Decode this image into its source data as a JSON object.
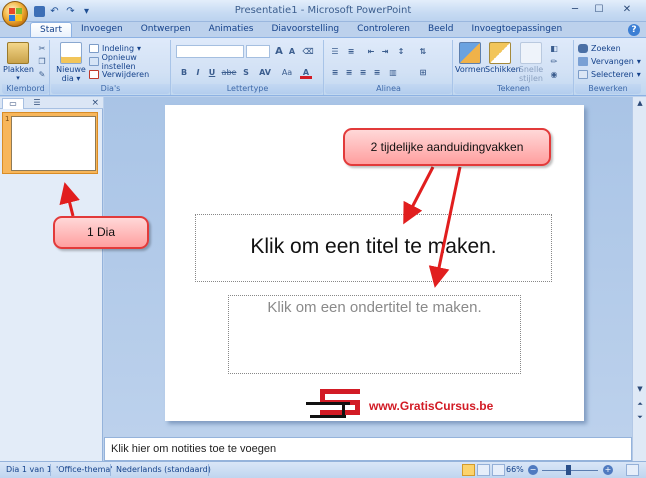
{
  "window": {
    "title": "Presentatie1 - Microsoft PowerPoint"
  },
  "tabs": [
    "Start",
    "Invoegen",
    "Ontwerpen",
    "Animaties",
    "Diavoorstelling",
    "Controleren",
    "Beeld",
    "Invoegtoepassingen"
  ],
  "ribbon": {
    "klembord": {
      "label": "Klembord",
      "paste": "Plakken"
    },
    "dias": {
      "label": "Dia's",
      "new_slide_1": "Nieuwe",
      "new_slide_2": "dia",
      "layout": "Indeling",
      "reset": "Opnieuw instellen",
      "delete": "Verwijderen"
    },
    "lettertype": {
      "label": "Lettertype",
      "bold": "B",
      "italic": "I",
      "underline": "U",
      "strike": "abe",
      "shadow": "S",
      "spacing": "AV",
      "case": "Aa",
      "grow": "A",
      "shrink": "A"
    },
    "alinea": {
      "label": "Alinea"
    },
    "tekenen": {
      "label": "Tekenen",
      "shapes": "Vormen",
      "arrange": "Schikken",
      "quick_styles_1": "Snelle",
      "quick_styles_2": "stijlen"
    },
    "bewerken": {
      "label": "Bewerken",
      "find": "Zoeken",
      "replace": "Vervangen",
      "select": "Selecteren"
    }
  },
  "slide_pane": {
    "thumb_number": "1"
  },
  "slide": {
    "title_placeholder": "Klik om een titel te maken.",
    "subtitle_placeholder": "Klik om een ondertitel te maken.",
    "logo_text": "www.GratisCursus.be"
  },
  "callouts": {
    "placeholders": "2 tijdelijke aanduidingvakken",
    "slide": "1 Dia"
  },
  "notes": {
    "placeholder": "Klik hier om notities toe te voegen"
  },
  "status": {
    "slide": "Dia 1 van 1",
    "theme": "'Office-thema'",
    "language": "Nederlands (standaard)",
    "zoom": "66%"
  },
  "colors": {
    "callout_fill": "#ff9f9f",
    "callout_border": "#e23a3a",
    "thumb_selected": "#f7b65b",
    "logo_red": "#d21b25"
  }
}
